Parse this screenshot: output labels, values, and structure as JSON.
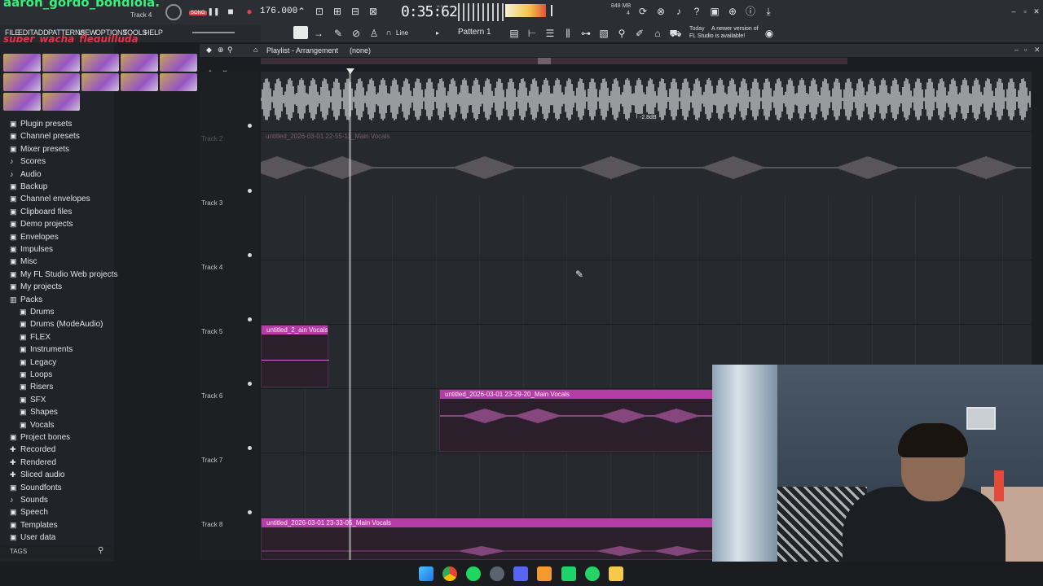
{
  "overlay": {
    "channel_name": "aaron_gordo_bondiola.",
    "user_name": "super_wacha_flequilluda"
  },
  "hint_bar": {
    "track_label": "Track 4",
    "song_label": "SONG"
  },
  "transport": {
    "tempo": "176.000",
    "time": "0:35:62",
    "time_unit": "M:S:CS",
    "memory": "848 MB",
    "cpu_count": "4"
  },
  "update_notice": {
    "today": "Today",
    "line1": "A newer version of",
    "line2": "FL Studio is available!"
  },
  "menu": [
    "FILE",
    "EDIT",
    "ADD",
    "PATTERNS",
    "VIEW",
    "OPTIONS",
    "TOOLS",
    "HELP"
  ],
  "toolbar": {
    "snap_label": "Line",
    "pattern_label": "Pattern 1"
  },
  "playlist": {
    "title": "Playlist - Arrangement",
    "pattern": "(none)",
    "volume_tip": "-2.8dB"
  },
  "browser": {
    "items": [
      {
        "label": "Plugin presets",
        "icon": "folder-icon",
        "sub": false
      },
      {
        "label": "Channel presets",
        "icon": "folder-icon",
        "sub": false
      },
      {
        "label": "Mixer presets",
        "icon": "folder-icon",
        "sub": false
      },
      {
        "label": "Scores",
        "icon": "note-icon",
        "sub": false
      },
      {
        "label": "Audio",
        "icon": "note-icon",
        "sub": false
      },
      {
        "label": "Backup",
        "icon": "folder-icon",
        "sub": false
      },
      {
        "label": "Channel envelopes",
        "icon": "folder-icon",
        "sub": false
      },
      {
        "label": "Clipboard files",
        "icon": "folder-icon",
        "sub": false
      },
      {
        "label": "Demo projects",
        "icon": "folder-icon",
        "sub": false
      },
      {
        "label": "Envelopes",
        "icon": "folder-icon",
        "sub": false
      },
      {
        "label": "Impulses",
        "icon": "folder-icon",
        "sub": false
      },
      {
        "label": "Misc",
        "icon": "folder-icon",
        "sub": false
      },
      {
        "label": "My FL Studio Web projects",
        "icon": "folder-icon",
        "sub": false
      },
      {
        "label": "My projects",
        "icon": "folder-icon",
        "sub": false
      },
      {
        "label": "Packs",
        "icon": "folder-open-icon",
        "sub": false
      },
      {
        "label": "Drums",
        "icon": "folder-icon",
        "sub": true
      },
      {
        "label": "Drums (ModeAudio)",
        "icon": "folder-icon",
        "sub": true
      },
      {
        "label": "FLEX",
        "icon": "folder-icon",
        "sub": true
      },
      {
        "label": "Instruments",
        "icon": "folder-icon",
        "sub": true
      },
      {
        "label": "Legacy",
        "icon": "folder-icon",
        "sub": true
      },
      {
        "label": "Loops",
        "icon": "folder-icon",
        "sub": true
      },
      {
        "label": "Risers",
        "icon": "folder-icon",
        "sub": true
      },
      {
        "label": "SFX",
        "icon": "folder-icon",
        "sub": true
      },
      {
        "label": "Shapes",
        "icon": "folder-icon",
        "sub": true
      },
      {
        "label": "Vocals",
        "icon": "folder-icon",
        "sub": true
      },
      {
        "label": "Project bones",
        "icon": "folder-icon",
        "sub": false
      },
      {
        "label": "Recorded",
        "icon": "plus-icon",
        "sub": false
      },
      {
        "label": "Rendered",
        "icon": "plus-icon",
        "sub": false
      },
      {
        "label": "Sliced audio",
        "icon": "plus-icon",
        "sub": false
      },
      {
        "label": "Soundfonts",
        "icon": "folder-icon",
        "sub": false
      },
      {
        "label": "Sounds",
        "icon": "note-icon",
        "sub": false
      },
      {
        "label": "Speech",
        "icon": "folder-icon",
        "sub": false
      },
      {
        "label": "Templates",
        "icon": "folder-icon",
        "sub": false
      },
      {
        "label": "User data",
        "icon": "folder-icon",
        "sub": false
      }
    ],
    "tags_label": "TAGS"
  },
  "tracks": [
    {
      "name": "Track 2"
    },
    {
      "name": "Track 3"
    },
    {
      "name": "Track 4"
    },
    {
      "name": "Track 5"
    },
    {
      "name": "Track 6"
    },
    {
      "name": "Track 7"
    },
    {
      "name": "Track 8"
    }
  ],
  "clips": {
    "track2": "untitled_2026-03-01 22-55-11_Main Vocals",
    "track5": "untitled_2_ain Vocals",
    "track6": "untitled_2026-03-01 23-29-20_Main Vocals",
    "track8": "untitled_2026-03-01 23-33-05_Main Vocals"
  },
  "colors": {
    "clip_header": "#b43ea6",
    "overlay_green": "#38f07a",
    "overlay_red": "#e4344a",
    "waveform_top": "#e6e6ea"
  }
}
